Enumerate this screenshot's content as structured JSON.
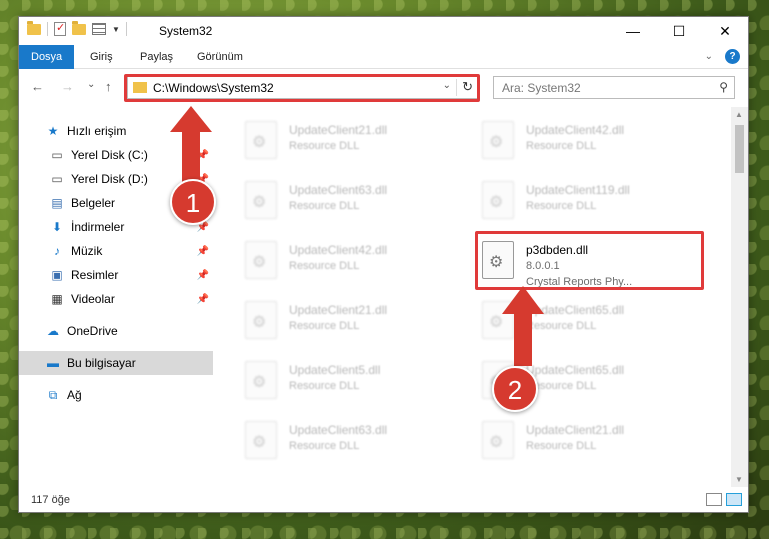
{
  "window": {
    "title": "System32",
    "controls": {
      "minimize": "—",
      "maximize": "☐",
      "close": "✕"
    }
  },
  "ribbon": {
    "tabs": [
      "Dosya",
      "Giriş",
      "Paylaş",
      "Görünüm"
    ],
    "help": "?"
  },
  "nav": {
    "back": "←",
    "forward": "→",
    "recent": "⌄",
    "up": "↑",
    "address": "C:\\Windows\\System32",
    "search_placeholder": "Ara: System32"
  },
  "sidebar": {
    "items": [
      {
        "label": "Hızlı erişim",
        "icon": "star-icon",
        "glyph": "★",
        "color": "#1979ca",
        "pinned": false
      },
      {
        "label": "Yerel Disk (C:)",
        "icon": "drive-icon",
        "glyph": "▭",
        "color": "#555",
        "pinned": true
      },
      {
        "label": "Yerel Disk (D:)",
        "icon": "drive-icon",
        "glyph": "▭",
        "color": "#555",
        "pinned": true
      },
      {
        "label": "Belgeler",
        "icon": "documents-icon",
        "glyph": "▤",
        "color": "#3a6fb0",
        "pinned": true
      },
      {
        "label": "İndirmeler",
        "icon": "download-icon",
        "glyph": "⬇",
        "color": "#1979ca",
        "pinned": true
      },
      {
        "label": "Müzik",
        "icon": "music-icon",
        "glyph": "♪",
        "color": "#1979ca",
        "pinned": true
      },
      {
        "label": "Resimler",
        "icon": "pictures-icon",
        "glyph": "▣",
        "color": "#3a6fb0",
        "pinned": true
      },
      {
        "label": "Videolar",
        "icon": "video-icon",
        "glyph": "▦",
        "color": "#333",
        "pinned": true
      },
      {
        "label": "OneDrive",
        "icon": "cloud-icon",
        "glyph": "☁",
        "color": "#1979ca",
        "pinned": false
      },
      {
        "label": "Bu bilgisayar",
        "icon": "computer-icon",
        "glyph": "▬",
        "color": "#1979ca",
        "pinned": false,
        "selected": true
      },
      {
        "label": "Ağ",
        "icon": "network-icon",
        "glyph": "⧉",
        "color": "#1979ca",
        "pinned": false
      }
    ]
  },
  "files": {
    "left": [
      {
        "name": "UpdateClient21.dll",
        "type": "Resource DLL"
      },
      {
        "name": "UpdateClient63.dll",
        "type": "Resource DLL"
      },
      {
        "name": "UpdateClient42.dll",
        "type": "Resource DLL"
      },
      {
        "name": "UpdateClient21.dll",
        "type": "Resource DLL"
      },
      {
        "name": "UpdateClient5.dll",
        "type": "Resource DLL"
      },
      {
        "name": "UpdateClient63.dll",
        "type": "Resource DLL"
      }
    ],
    "right": [
      {
        "name": "UpdateClient42.dll",
        "type": "Resource DLL"
      },
      {
        "name": "UpdateClient119.dll",
        "type": "Resource DLL"
      },
      {
        "name": "p3dbden.dll",
        "type": "8.0.0.1",
        "description": "Crystal Reports Phy...",
        "highlight": true
      },
      {
        "name": "UpdateClient65.dll",
        "type": "Resource DLL"
      },
      {
        "name": "UpdateClient65.dll",
        "type": "Resource DLL"
      },
      {
        "name": "UpdateClient21.dll",
        "type": "Resource DLL"
      }
    ]
  },
  "status": {
    "count": "117 öğe"
  },
  "annotations": {
    "badge1": "1",
    "badge2": "2",
    "color": "#e03a3a"
  }
}
